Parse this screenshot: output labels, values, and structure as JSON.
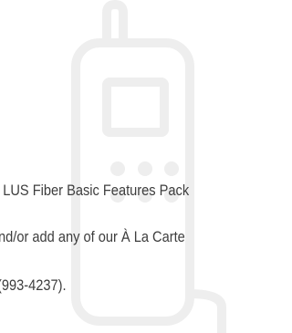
{
  "background_graphic": {
    "icon": "cordless-phone-icon",
    "stroke_color": "#eeeeee",
    "background_color": "#ffffff"
  },
  "body_text": {
    "line_1": "e LUS Fiber Basic Features Pack",
    "line_2": "nd/or add any of our À La Carte",
    "line_3": "(993-4237).",
    "color": "#3d3d3d"
  }
}
